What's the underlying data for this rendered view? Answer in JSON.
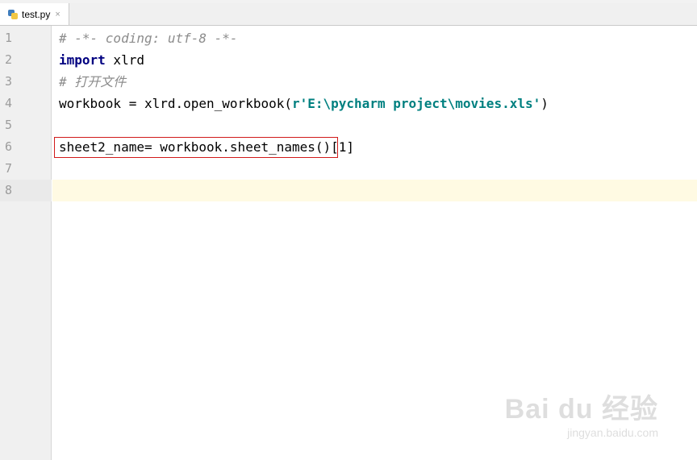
{
  "tab": {
    "filename": "test.py",
    "close_glyph": "×",
    "icon": "python-file-icon"
  },
  "gutter": {
    "line_numbers": [
      "1",
      "2",
      "3",
      "4",
      "5",
      "6",
      "7",
      "8"
    ]
  },
  "code_lines": {
    "l1": {
      "comment": "# -*- coding: utf-8 -*-"
    },
    "l2": {
      "keyword": "import",
      "rest": " xlrd"
    },
    "l3": {
      "comment": "# 打开文件"
    },
    "l4": {
      "pre": "workbook = xlrd.open_workbook(",
      "string": "r'E:\\pycharm project\\movies.xls'",
      "post": ")"
    },
    "l6": {
      "text": "sheet2_name= workbook.sheet_names()[1]"
    }
  },
  "watermark": {
    "logo": "Bai du 经验",
    "url": "jingyan.baidu.com"
  },
  "colors": {
    "keyword": "#000080",
    "string": "#008080",
    "comment": "#8c8c8c",
    "current_line": "#fffae3",
    "highlight_box": "#d11a1a"
  }
}
